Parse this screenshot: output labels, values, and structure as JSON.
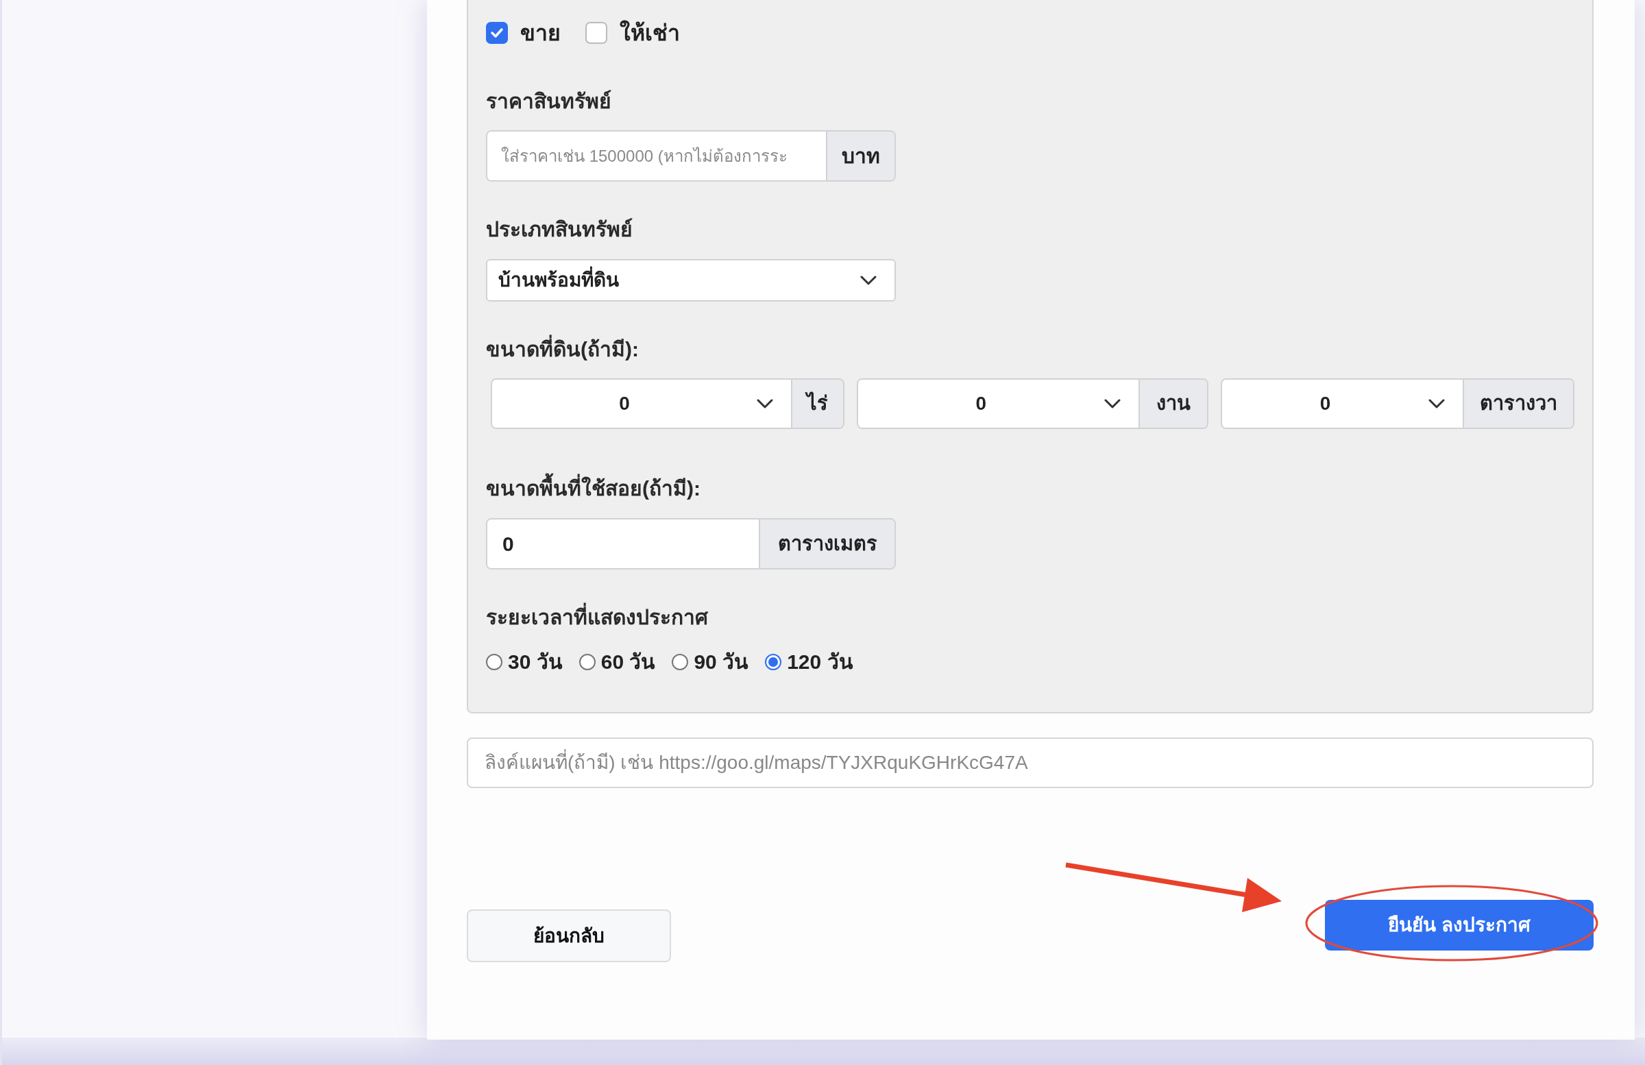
{
  "listing_type": [
    {
      "label": "ขาย",
      "checked": true
    },
    {
      "label": "ให้เช่า",
      "checked": false
    }
  ],
  "price": {
    "label": "ราคาสินทรัพย์",
    "placeholder": "ใส่ราคาเช่น 1500000 (หากไม่ต้องการระ",
    "unit": "บาท"
  },
  "property_type": {
    "label": "ประเภทสินทรัพย์",
    "value": "บ้านพร้อมที่ดิน"
  },
  "land_size": {
    "label": "ขนาดที่ดิน(ถ้ามี):",
    "fields": [
      {
        "value": "0",
        "unit": "ไร่"
      },
      {
        "value": "0",
        "unit": "งาน"
      },
      {
        "value": "0",
        "unit": "ตารางวา"
      }
    ]
  },
  "usable_area": {
    "label": "ขนาดพื้นที่ใช้สอย(ถ้ามี):",
    "value": "0",
    "unit": "ตารางเมตร"
  },
  "duration": {
    "label": "ระยะเวลาที่แสดงประกาศ",
    "options": [
      {
        "label": "30 วัน",
        "selected": false
      },
      {
        "label": "60 วัน",
        "selected": false
      },
      {
        "label": "90 วัน",
        "selected": false
      },
      {
        "label": "120 วัน",
        "selected": true
      }
    ]
  },
  "map_link": {
    "placeholder": "ลิงค์แผนที่(ถ้ามี) เช่น https://goo.gl/maps/TYJXRquKGHrKcG47A"
  },
  "buttons": {
    "back": "ย้อนกลับ",
    "submit": "ยืนยัน ลงประกาศ"
  }
}
